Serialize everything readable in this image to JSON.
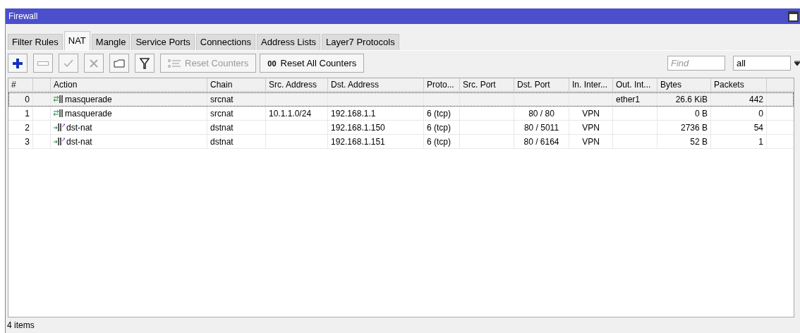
{
  "window": {
    "title": "Firewall"
  },
  "tabs": [
    {
      "label": "Filter Rules",
      "selected": false
    },
    {
      "label": "NAT",
      "selected": true
    },
    {
      "label": "Mangle",
      "selected": false
    },
    {
      "label": "Service Ports",
      "selected": false
    },
    {
      "label": "Connections",
      "selected": false
    },
    {
      "label": "Address Lists",
      "selected": false
    },
    {
      "label": "Layer7 Protocols",
      "selected": false
    }
  ],
  "toolbar": {
    "buttons": [
      {
        "kind": "add",
        "disabled": false
      },
      {
        "kind": "remove",
        "disabled": true
      },
      {
        "kind": "enable",
        "disabled": true
      },
      {
        "kind": "disable",
        "disabled": true
      },
      {
        "kind": "comment",
        "disabled": false
      },
      {
        "kind": "filter",
        "disabled": false
      }
    ],
    "reset_counters": {
      "label": "Reset Counters",
      "disabled": true
    },
    "reset_all": {
      "icon_text": "00",
      "label": "Reset All Counters",
      "disabled": false
    },
    "find": {
      "placeholder": "Find"
    },
    "scope": {
      "value": "all"
    }
  },
  "table": {
    "columns": [
      "#",
      "",
      "Action",
      "Chain",
      "Src. Address",
      "Dst. Address",
      "Proto...",
      "Src. Port",
      "Dst. Port",
      "In. Inter...",
      "Out. Int...",
      "Bytes",
      "Packets",
      ""
    ],
    "rows": [
      {
        "selected": true,
        "cells": [
          "0",
          "",
          "masquerade",
          "srcnat",
          "",
          "",
          "",
          "",
          "",
          "",
          "ether1",
          "26.6 KiB",
          "442"
        ],
        "kind": "masquerade"
      },
      {
        "selected": false,
        "cells": [
          "1",
          "",
          "masquerade",
          "srcnat",
          "10.1.1.0/24",
          "192.168.1.1",
          "6 (tcp)",
          "",
          "80 / 80",
          "VPN",
          "",
          "0 B",
          "0"
        ],
        "kind": "masquerade"
      },
      {
        "selected": false,
        "cells": [
          "2",
          "",
          "dst-nat",
          "dstnat",
          "",
          "192.168.1.150",
          "6 (tcp)",
          "",
          "80 / 5011",
          "VPN",
          "",
          "2736 B",
          "54"
        ],
        "kind": "dst-nat"
      },
      {
        "selected": false,
        "cells": [
          "3",
          "",
          "dst-nat",
          "dstnat",
          "",
          "192.168.1.151",
          "6 (tcp)",
          "",
          "80 / 6164",
          "VPN",
          "",
          "52 B",
          "1"
        ],
        "kind": "dst-nat"
      }
    ]
  },
  "status_bar": "4 items"
}
